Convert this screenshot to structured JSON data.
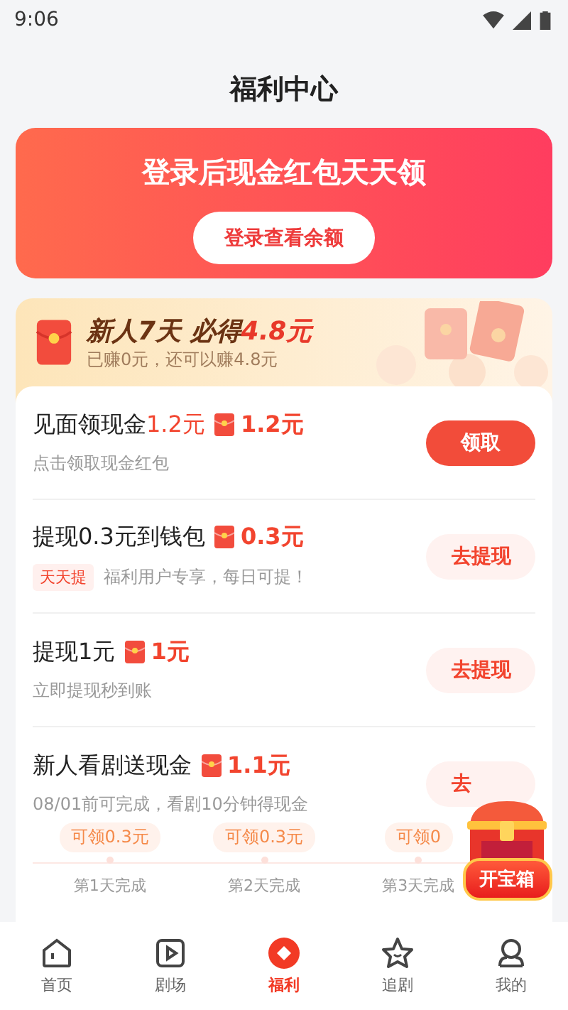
{
  "status_bar": {
    "time": "9:06"
  },
  "page_title": "福利中心",
  "login_banner": {
    "headline": "登录后现金红包天天领",
    "button": "登录查看余额"
  },
  "newbie": {
    "title": "新人7天 必得",
    "amount": "4.8元",
    "subtitle": "已赚0元，还可以赚4.8元"
  },
  "tasks": [
    {
      "title": "见面领现金",
      "title_amount": "1.2元",
      "reward": "1.2元",
      "desc": "点击领取现金红包",
      "button": "领取",
      "primary": true
    },
    {
      "title": "提现0.3元到钱包",
      "reward": "0.3元",
      "tag": "天天提",
      "desc": "福利用户专享，每日可提！",
      "button": "去提现",
      "primary": false
    },
    {
      "title": "提现1元",
      "reward": "1元",
      "desc": "立即提现秒到账",
      "button": "去提现",
      "primary": false
    },
    {
      "title": "新人看剧送现金",
      "reward": "1.1元",
      "desc": "08/01前可完成，看剧10分钟得现金",
      "button": "去",
      "primary": false,
      "steps": [
        {
          "bubble": "可领0.3元",
          "label": "第1天完成"
        },
        {
          "bubble": "可领0.3元",
          "label": "第2天完成"
        },
        {
          "bubble": "可领0",
          "label": "第3天完成"
        }
      ]
    }
  ],
  "treasure_chest": {
    "label": "开宝箱"
  },
  "tab_bar": [
    {
      "label": "首页",
      "selected": false
    },
    {
      "label": "剧场",
      "selected": false
    },
    {
      "label": "福利",
      "selected": true
    },
    {
      "label": "追剧",
      "selected": false
    },
    {
      "label": "我的",
      "selected": false
    }
  ]
}
